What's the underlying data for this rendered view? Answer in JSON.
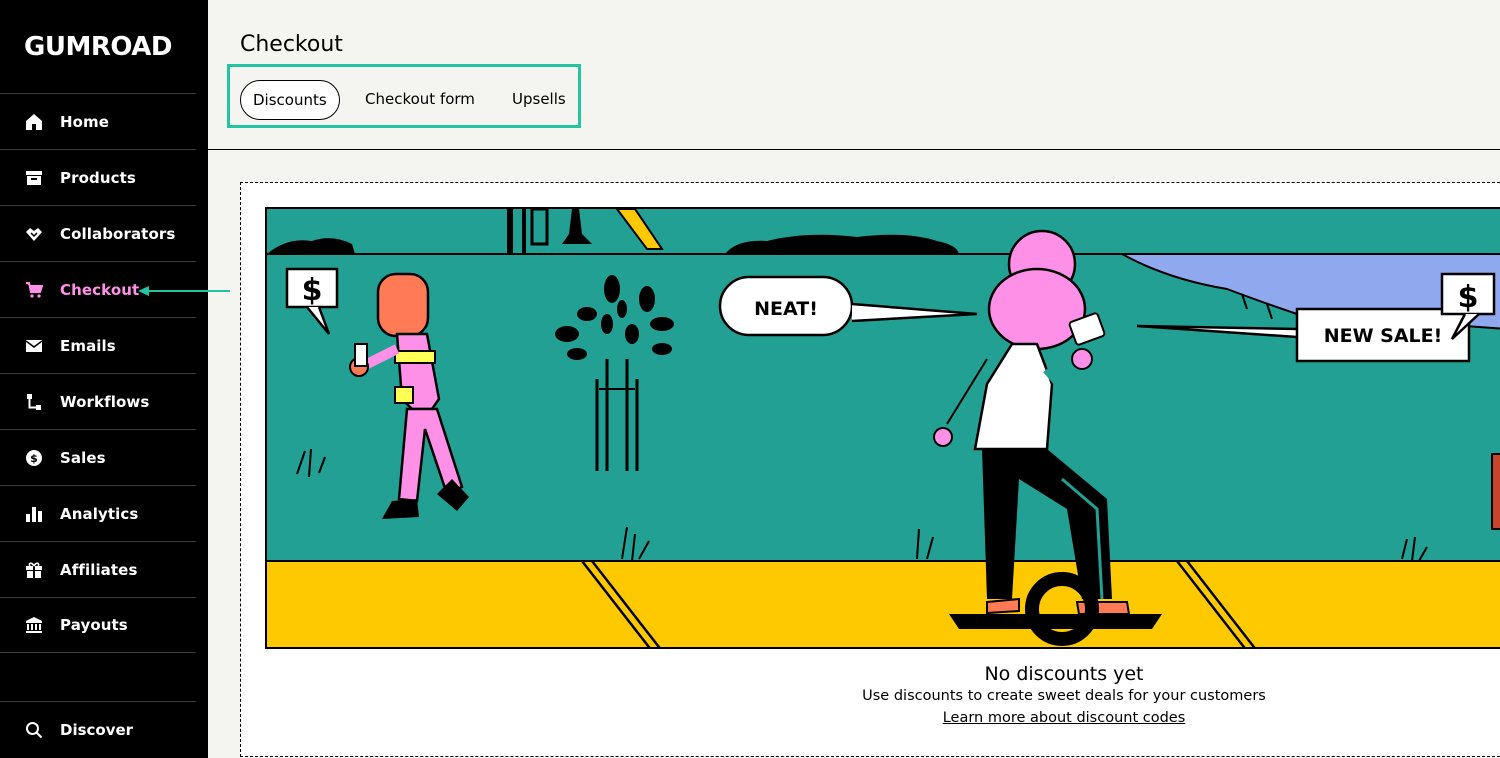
{
  "app": {
    "logo_text": "GUMROAD"
  },
  "sidebar": {
    "items": [
      {
        "label": "Home",
        "icon": "home-icon"
      },
      {
        "label": "Products",
        "icon": "archive-icon"
      },
      {
        "label": "Collaborators",
        "icon": "handshake-icon"
      },
      {
        "label": "Checkout",
        "icon": "cart-icon",
        "active": true
      },
      {
        "label": "Emails",
        "icon": "envelope-icon"
      },
      {
        "label": "Workflows",
        "icon": "workflow-icon"
      },
      {
        "label": "Sales",
        "icon": "dollar-circle-icon"
      },
      {
        "label": "Analytics",
        "icon": "bar-chart-icon"
      },
      {
        "label": "Affiliates",
        "icon": "gift-icon"
      },
      {
        "label": "Payouts",
        "icon": "bank-icon"
      }
    ],
    "discover": {
      "label": "Discover",
      "icon": "search-icon"
    }
  },
  "header": {
    "title": "Checkout",
    "tabs": [
      {
        "label": "Discounts",
        "active": true
      },
      {
        "label": "Checkout form",
        "active": false
      },
      {
        "label": "Upsells",
        "active": false
      }
    ]
  },
  "illustration": {
    "bubble_left": "NEAT!",
    "bubble_right": "NEW SALE!"
  },
  "empty_state": {
    "title": "No discounts yet",
    "description": "Use discounts to create sweet deals for your customers",
    "link": "Learn more about discount codes"
  },
  "colors": {
    "accent_pink": "#ff90e8",
    "highlight_teal": "#23c4a0",
    "scene_teal": "#23a094",
    "scene_yellow": "#ffc900",
    "scene_lavender": "#90a8ed"
  }
}
